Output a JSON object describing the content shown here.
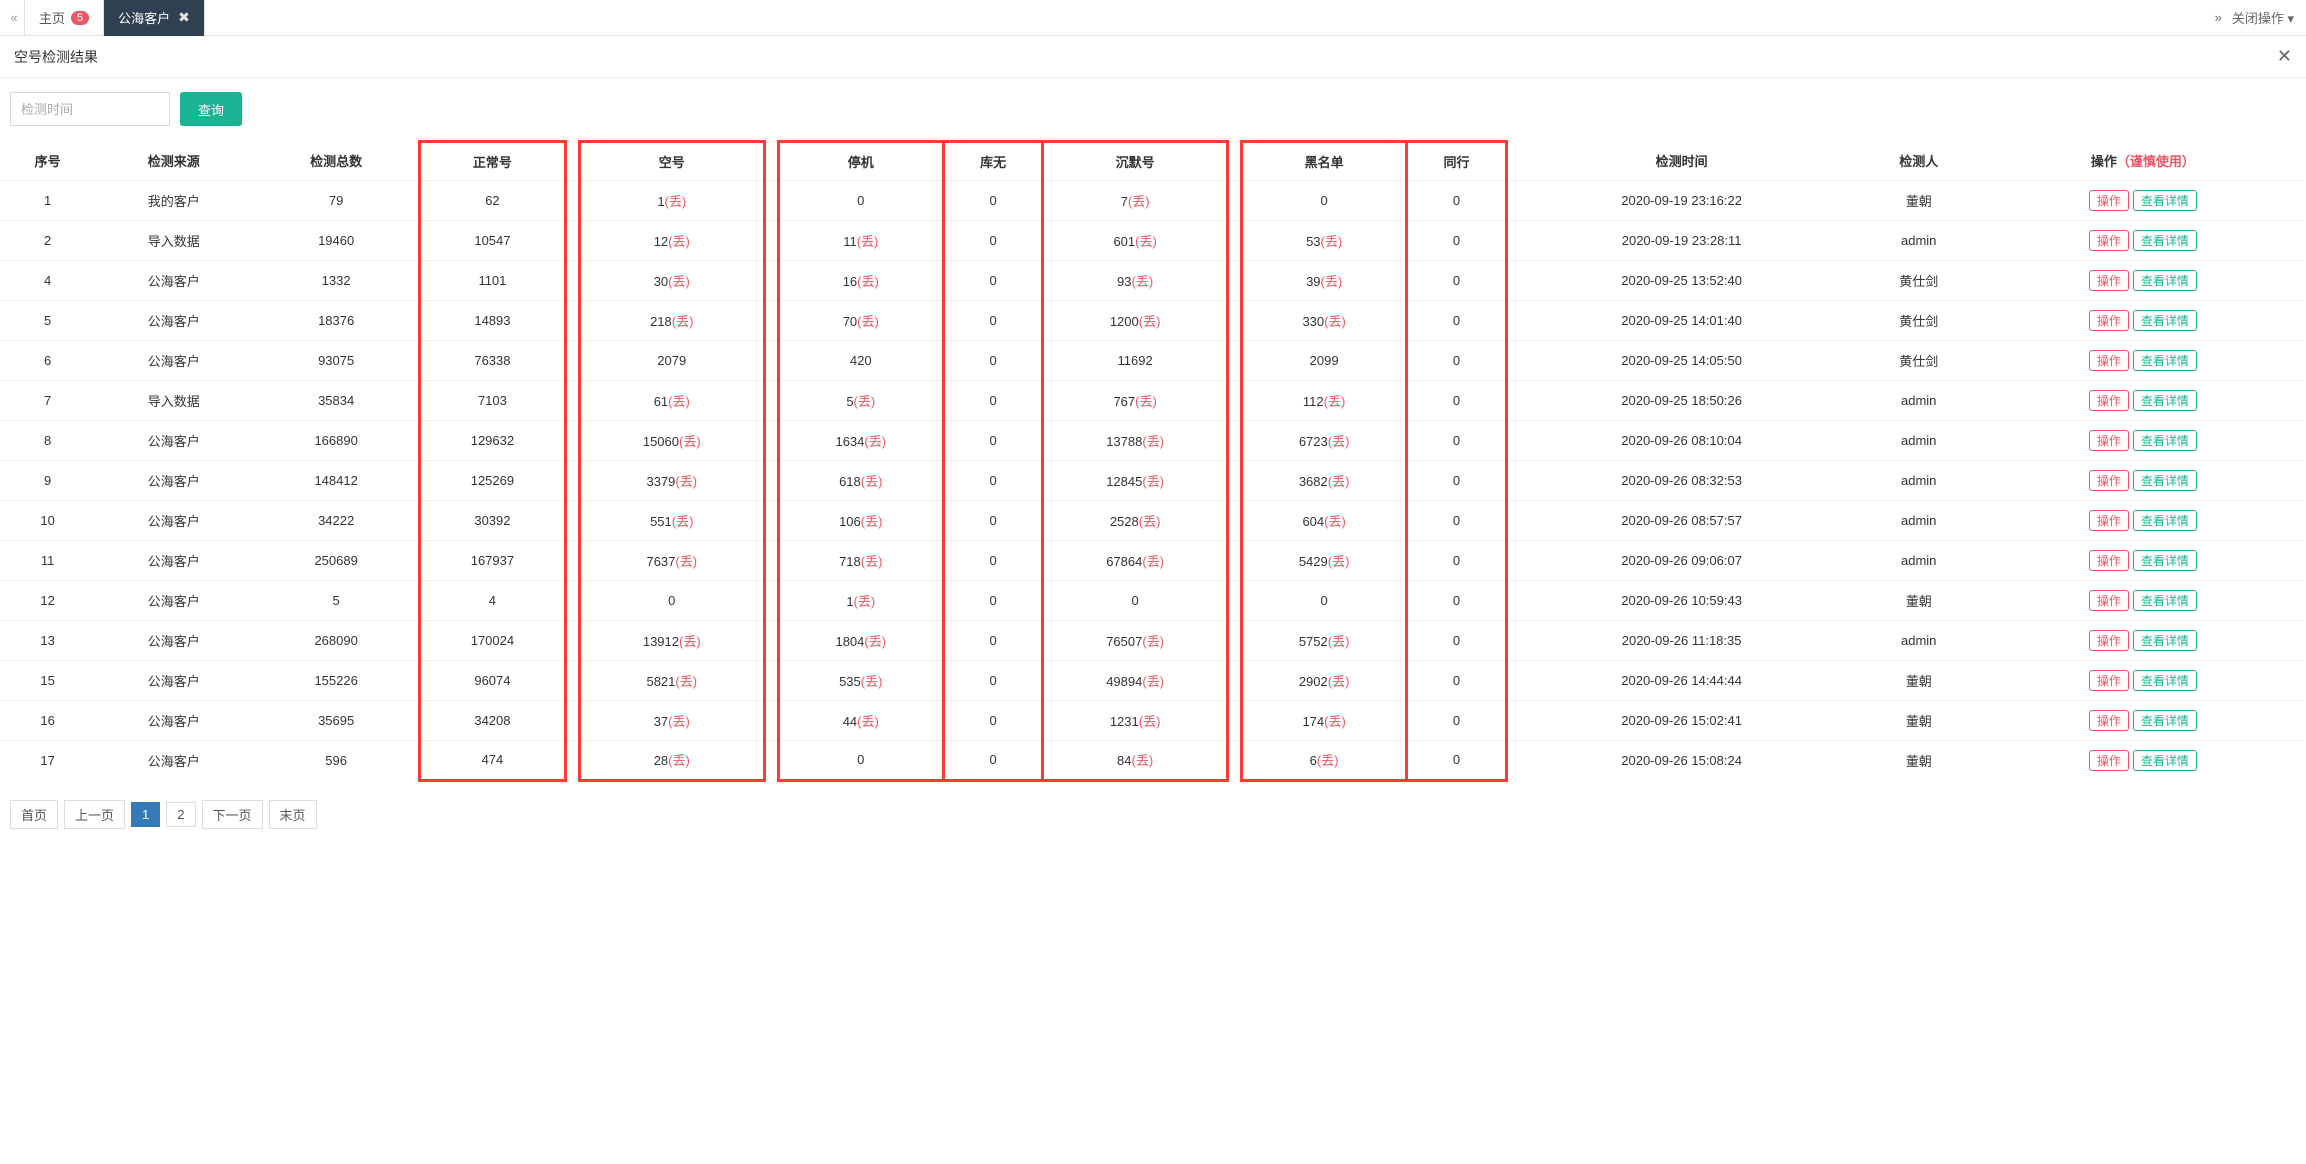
{
  "tabs": {
    "nav_prev_glyph": "«",
    "home": "主页",
    "home_badge": "5",
    "active": "公海客户",
    "close_glyph": "✖",
    "nav_next_glyph": "»",
    "close_ops": "关闭操作",
    "caret": "▾"
  },
  "panel": {
    "title": "空号检测结果",
    "close_glyph": "✕"
  },
  "filter": {
    "placeholder": "检测时间",
    "query": "查询"
  },
  "columns": {
    "seq": "序号",
    "source": "检测来源",
    "total": "检测总数",
    "normal": "正常号",
    "empty": "空号",
    "suspended": "停机",
    "no_stock": "库无",
    "silent": "沉默号",
    "blacklist": "黑名单",
    "peer": "同行",
    "time": "检测时间",
    "operator": "检测人",
    "actions": "操作",
    "actions_caution": "（谨慎使用）"
  },
  "labels": {
    "discard_suffix": "(丢)",
    "btn_op": "操作",
    "btn_detail": "查看详情"
  },
  "pagination": {
    "first": "首页",
    "prev": "上一页",
    "p1": "1",
    "p2": "2",
    "next": "下一页",
    "last": "末页"
  },
  "rows": [
    {
      "seq": "1",
      "source": "我的客户",
      "total": "79",
      "normal": "62",
      "empty": "1",
      "empty_d": true,
      "suspended": "0",
      "suspended_d": false,
      "no_stock": "0",
      "silent": "7",
      "silent_d": true,
      "blacklist": "0",
      "blacklist_d": false,
      "peer": "0",
      "time": "2020-09-19 23:16:22",
      "operator": "董朝"
    },
    {
      "seq": "2",
      "source": "导入数据",
      "total": "19460",
      "normal": "10547",
      "empty": "12",
      "empty_d": true,
      "suspended": "11",
      "suspended_d": true,
      "no_stock": "0",
      "silent": "601",
      "silent_d": true,
      "blacklist": "53",
      "blacklist_d": true,
      "peer": "0",
      "time": "2020-09-19 23:28:11",
      "operator": "admin"
    },
    {
      "seq": "4",
      "source": "公海客户",
      "total": "1332",
      "normal": "1101",
      "empty": "30",
      "empty_d": true,
      "suspended": "16",
      "suspended_d": true,
      "no_stock": "0",
      "silent": "93",
      "silent_d": true,
      "blacklist": "39",
      "blacklist_d": true,
      "peer": "0",
      "time": "2020-09-25 13:52:40",
      "operator": "黄仕剑"
    },
    {
      "seq": "5",
      "source": "公海客户",
      "total": "18376",
      "normal": "14893",
      "empty": "218",
      "empty_d": true,
      "suspended": "70",
      "suspended_d": true,
      "no_stock": "0",
      "silent": "1200",
      "silent_d": true,
      "blacklist": "330",
      "blacklist_d": true,
      "peer": "0",
      "time": "2020-09-25 14:01:40",
      "operator": "黄仕剑"
    },
    {
      "seq": "6",
      "source": "公海客户",
      "total": "93075",
      "normal": "76338",
      "empty": "2079",
      "empty_d": false,
      "suspended": "420",
      "suspended_d": false,
      "no_stock": "0",
      "silent": "11692",
      "silent_d": false,
      "blacklist": "2099",
      "blacklist_d": false,
      "peer": "0",
      "time": "2020-09-25 14:05:50",
      "operator": "黄仕剑"
    },
    {
      "seq": "7",
      "source": "导入数据",
      "total": "35834",
      "normal": "7103",
      "empty": "61",
      "empty_d": true,
      "suspended": "5",
      "suspended_d": true,
      "no_stock": "0",
      "silent": "767",
      "silent_d": true,
      "blacklist": "112",
      "blacklist_d": true,
      "peer": "0",
      "time": "2020-09-25 18:50:26",
      "operator": "admin"
    },
    {
      "seq": "8",
      "source": "公海客户",
      "total": "166890",
      "normal": "129632",
      "empty": "15060",
      "empty_d": true,
      "suspended": "1634",
      "suspended_d": true,
      "no_stock": "0",
      "silent": "13788",
      "silent_d": true,
      "blacklist": "6723",
      "blacklist_d": true,
      "peer": "0",
      "time": "2020-09-26 08:10:04",
      "operator": "admin"
    },
    {
      "seq": "9",
      "source": "公海客户",
      "total": "148412",
      "normal": "125269",
      "empty": "3379",
      "empty_d": true,
      "suspended": "618",
      "suspended_d": true,
      "no_stock": "0",
      "silent": "12845",
      "silent_d": true,
      "blacklist": "3682",
      "blacklist_d": true,
      "peer": "0",
      "time": "2020-09-26 08:32:53",
      "operator": "admin"
    },
    {
      "seq": "10",
      "source": "公海客户",
      "total": "34222",
      "normal": "30392",
      "empty": "551",
      "empty_d": true,
      "suspended": "106",
      "suspended_d": true,
      "no_stock": "0",
      "silent": "2528",
      "silent_d": true,
      "blacklist": "604",
      "blacklist_d": true,
      "peer": "0",
      "time": "2020-09-26 08:57:57",
      "operator": "admin"
    },
    {
      "seq": "11",
      "source": "公海客户",
      "total": "250689",
      "normal": "167937",
      "empty": "7637",
      "empty_d": true,
      "suspended": "718",
      "suspended_d": true,
      "no_stock": "0",
      "silent": "67864",
      "silent_d": true,
      "blacklist": "5429",
      "blacklist_d": true,
      "peer": "0",
      "time": "2020-09-26 09:06:07",
      "operator": "admin"
    },
    {
      "seq": "12",
      "source": "公海客户",
      "total": "5",
      "normal": "4",
      "empty": "0",
      "empty_d": false,
      "suspended": "1",
      "suspended_d": true,
      "no_stock": "0",
      "silent": "0",
      "silent_d": false,
      "blacklist": "0",
      "blacklist_d": false,
      "peer": "0",
      "time": "2020-09-26 10:59:43",
      "operator": "董朝"
    },
    {
      "seq": "13",
      "source": "公海客户",
      "total": "268090",
      "normal": "170024",
      "empty": "13912",
      "empty_d": true,
      "suspended": "1804",
      "suspended_d": true,
      "no_stock": "0",
      "silent": "76507",
      "silent_d": true,
      "blacklist": "5752",
      "blacklist_d": true,
      "peer": "0",
      "time": "2020-09-26 11:18:35",
      "operator": "admin"
    },
    {
      "seq": "15",
      "source": "公海客户",
      "total": "155226",
      "normal": "96074",
      "empty": "5821",
      "empty_d": true,
      "suspended": "535",
      "suspended_d": true,
      "no_stock": "0",
      "silent": "49894",
      "silent_d": true,
      "blacklist": "2902",
      "blacklist_d": true,
      "peer": "0",
      "time": "2020-09-26 14:44:44",
      "operator": "董朝"
    },
    {
      "seq": "16",
      "source": "公海客户",
      "total": "35695",
      "normal": "34208",
      "empty": "37",
      "empty_d": true,
      "suspended": "44",
      "suspended_d": true,
      "no_stock": "0",
      "silent": "1231",
      "silent_d": true,
      "blacklist": "174",
      "blacklist_d": true,
      "peer": "0",
      "time": "2020-09-26 15:02:41",
      "operator": "董朝"
    },
    {
      "seq": "17",
      "source": "公海客户",
      "total": "596",
      "normal": "474",
      "empty": "28",
      "empty_d": true,
      "suspended": "0",
      "suspended_d": false,
      "no_stock": "0",
      "silent": "84",
      "silent_d": true,
      "blacklist": "6",
      "blacklist_d": true,
      "peer": "0",
      "time": "2020-09-26 15:08:24",
      "operator": "董朝"
    }
  ]
}
